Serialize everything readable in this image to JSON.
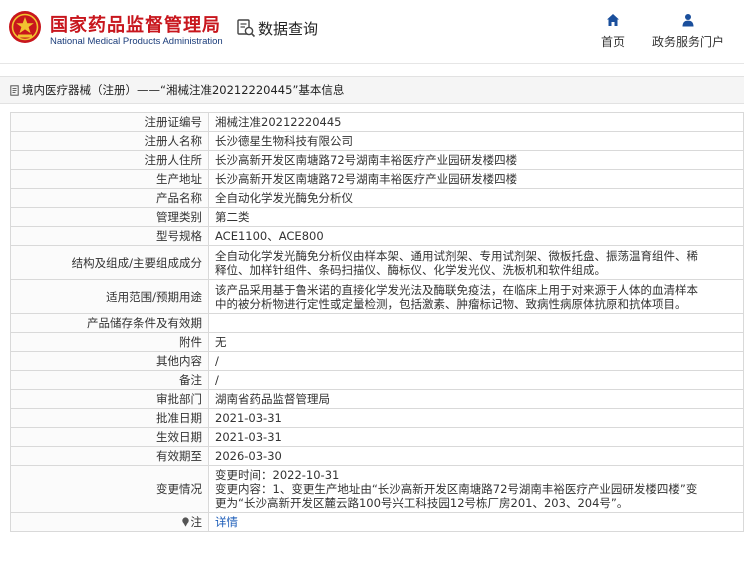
{
  "header": {
    "site_name": "国家药品监督管理局",
    "site_subtitle": "National Medical Products Administration",
    "query_label": "数据查询",
    "nav": [
      {
        "label": "首页",
        "icon": "home-icon"
      },
      {
        "label": "政务服务门户",
        "icon": "user-icon"
      }
    ],
    "colors": {
      "brand_red": "#c8161d",
      "subtitle_blue": "#1a3c7a",
      "nav_blue": "#1a4f9c"
    }
  },
  "breadcrumb": {
    "text": "境内医疗器械（注册）——“湘械注准20212220445”基本信息"
  },
  "rows": [
    {
      "label": "注册证编号",
      "value": "湘械注准20212220445"
    },
    {
      "label": "注册人名称",
      "value": "长沙德星生物科技有限公司"
    },
    {
      "label": "注册人住所",
      "value": "长沙高新开发区南塘路72号湖南丰裕医疗产业园研发楼四楼"
    },
    {
      "label": "生产地址",
      "value": "长沙高新开发区南塘路72号湖南丰裕医疗产业园研发楼四楼"
    },
    {
      "label": "产品名称",
      "value": "全自动化学发光酶免分析仪"
    },
    {
      "label": "管理类别",
      "value": "第二类"
    },
    {
      "label": "型号规格",
      "value": "ACE1100、ACE800"
    },
    {
      "label": "结构及组成/主要组成成分",
      "lines": [
        "全自动化学发光酶免分析仪由样本架、通用试剂架、专用试剂架、微板托盘、振荡温育组件、稀",
        "释位、加样针组件、条码扫描仪、酶标仪、化学发光仪、洗板机和软件组成。"
      ]
    },
    {
      "label": "适用范围/预期用途",
      "lines": [
        "该产品采用基于鲁米诺的直接化学发光法及酶联免疫法，在临床上用于对来源于人体的血清样本",
        "中的被分析物进行定性或定量检测，包括激素、肿瘤标记物、致病性病原体抗原和抗体项目。"
      ]
    },
    {
      "label": "产品储存条件及有效期",
      "value": ""
    },
    {
      "label": "附件",
      "value": "无"
    },
    {
      "label": "其他内容",
      "value": "/"
    },
    {
      "label": "备注",
      "value": "/"
    },
    {
      "label": "审批部门",
      "value": "湖南省药品监督管理局"
    },
    {
      "label": "批准日期",
      "value": "2021-03-31"
    },
    {
      "label": "生效日期",
      "value": "2021-03-31"
    },
    {
      "label": "有效期至",
      "value": "2026-03-30"
    },
    {
      "label": "变更情况",
      "lines": [
        "变更时间：2022-10-31",
        "变更内容：1、变更生产地址由“长沙高新开发区南塘路72号湖南丰裕医疗产业园研发楼四楼”变",
        "更为“长沙高新开发区麓云路100号兴工科技园12号栋厂房201、203、204号”。"
      ]
    },
    {
      "label": "注",
      "value": "详情",
      "label_icon": "pin-icon",
      "link": true
    }
  ]
}
